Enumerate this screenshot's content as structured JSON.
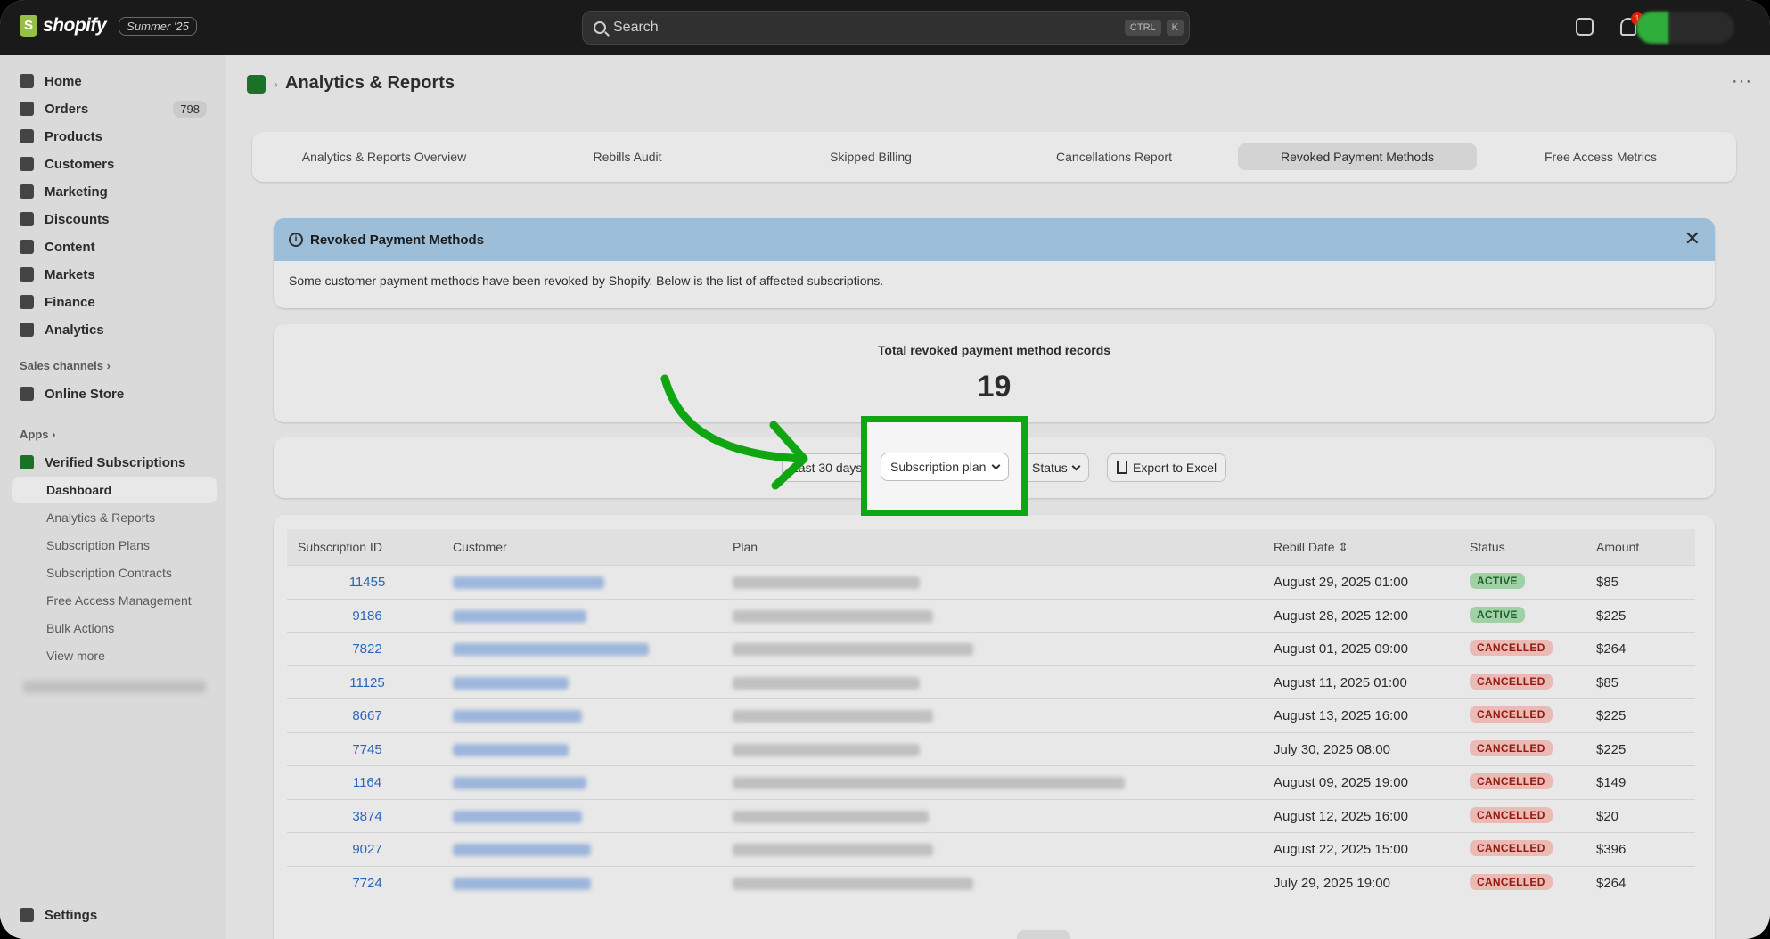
{
  "topbar": {
    "brand": "shopify",
    "edition": "Summer '25",
    "search_placeholder": "Search",
    "shortcut_ctrl": "CTRL",
    "shortcut_key": "K",
    "notification_count": "1"
  },
  "sidebar": {
    "items": [
      {
        "label": "Home",
        "icon": "home-icon"
      },
      {
        "label": "Orders",
        "icon": "orders-icon",
        "count": "798"
      },
      {
        "label": "Products",
        "icon": "tag-icon"
      },
      {
        "label": "Customers",
        "icon": "person-icon"
      },
      {
        "label": "Marketing",
        "icon": "target-icon"
      },
      {
        "label": "Discounts",
        "icon": "discount-icon"
      },
      {
        "label": "Content",
        "icon": "content-icon"
      },
      {
        "label": "Markets",
        "icon": "globe-icon"
      },
      {
        "label": "Finance",
        "icon": "bank-icon"
      },
      {
        "label": "Analytics",
        "icon": "chart-icon"
      }
    ],
    "sales_channels_label": "Sales channels",
    "online_store": "Online Store",
    "apps_label": "Apps",
    "app_name": "Verified Subscriptions",
    "app_items": [
      "Dashboard",
      "Analytics & Reports",
      "Subscription Plans",
      "Subscription Contracts",
      "Free Access Management",
      "Bulk Actions",
      "View more"
    ],
    "settings": "Settings"
  },
  "page": {
    "title": "Analytics & Reports",
    "tabs": [
      "Analytics & Reports Overview",
      "Rebills Audit",
      "Skipped Billing",
      "Cancellations Report",
      "Revoked Payment Methods",
      "Free Access Metrics"
    ],
    "active_tab": "Revoked Payment Methods"
  },
  "banner": {
    "title": "Revoked Payment Methods",
    "text": "Some customer payment methods have been revoked by Shopify. Below is the list of affected subscriptions."
  },
  "stats": {
    "label": "Total revoked payment method records",
    "value": "19"
  },
  "filters": {
    "date_range": "Last 30 days",
    "plan": "Subscription plan",
    "status": "Status",
    "export": "Export to Excel"
  },
  "table": {
    "headers": [
      "Subscription ID",
      "Customer",
      "Plan",
      "Rebill Date",
      "Status",
      "Amount"
    ],
    "rows": [
      {
        "id": "11455",
        "date": "August 29, 2025 01:00",
        "status": "ACTIVE",
        "amount": "$85"
      },
      {
        "id": "9186",
        "date": "August 28, 2025 12:00",
        "status": "ACTIVE",
        "amount": "$225"
      },
      {
        "id": "7822",
        "date": "August 01, 2025 09:00",
        "status": "CANCELLED",
        "amount": "$264"
      },
      {
        "id": "11125",
        "date": "August 11, 2025 01:00",
        "status": "CANCELLED",
        "amount": "$85"
      },
      {
        "id": "8667",
        "date": "August 13, 2025 16:00",
        "status": "CANCELLED",
        "amount": "$225"
      },
      {
        "id": "7745",
        "date": "July 30, 2025 08:00",
        "status": "CANCELLED",
        "amount": "$225"
      },
      {
        "id": "1164",
        "date": "August 09, 2025 19:00",
        "status": "CANCELLED",
        "amount": "$149"
      },
      {
        "id": "3874",
        "date": "August 12, 2025 16:00",
        "status": "CANCELLED",
        "amount": "$20"
      },
      {
        "id": "9027",
        "date": "August 22, 2025 15:00",
        "status": "CANCELLED",
        "amount": "$396"
      },
      {
        "id": "7724",
        "date": "July 29, 2025 19:00",
        "status": "CANCELLED",
        "amount": "$264"
      }
    ]
  },
  "colors": {
    "highlight": "#0fa612",
    "link": "#2c6ecb",
    "banner": "#a8cdea"
  }
}
